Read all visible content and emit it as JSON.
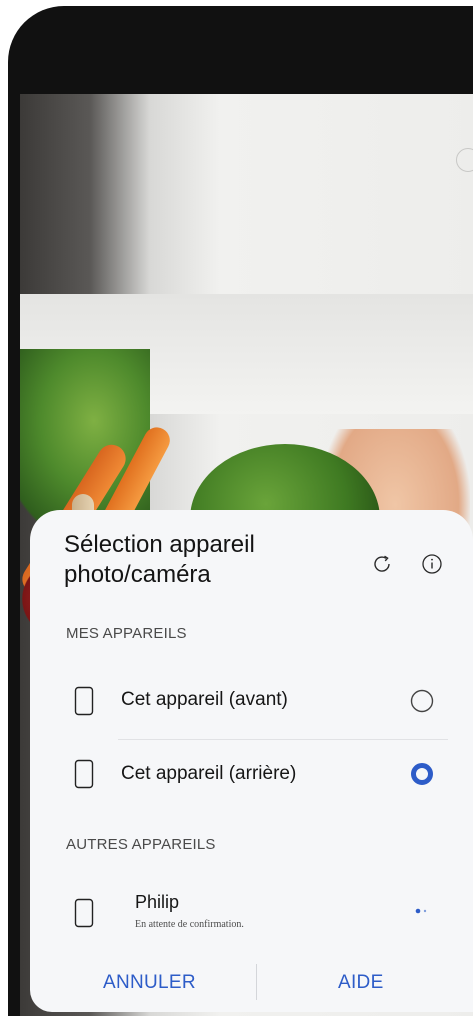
{
  "sheet": {
    "title": "Sélection appareil photo/caméra",
    "header_icons": [
      "refresh-icon",
      "info-icon"
    ],
    "my_devices_label": "MES APPAREILS",
    "my_devices": [
      {
        "label": "Cet appareil  (avant)",
        "icon": "phone-icon",
        "selected": false
      },
      {
        "label": "Cet appareil  (arrière)",
        "icon": "phone-icon",
        "selected": true
      }
    ],
    "other_devices_label": "AUTRES APPAREILS",
    "other_devices": [
      {
        "label": "Philip",
        "sublabel": "En attente de confirmation.",
        "icon": "phone-icon",
        "status": "loading"
      }
    ],
    "cancel_label": "ANNULER",
    "help_label": "AIDE"
  },
  "colors": {
    "accent": "#2d5cc8",
    "sheet_background": "#f6f7f9",
    "text_primary": "#161616"
  }
}
